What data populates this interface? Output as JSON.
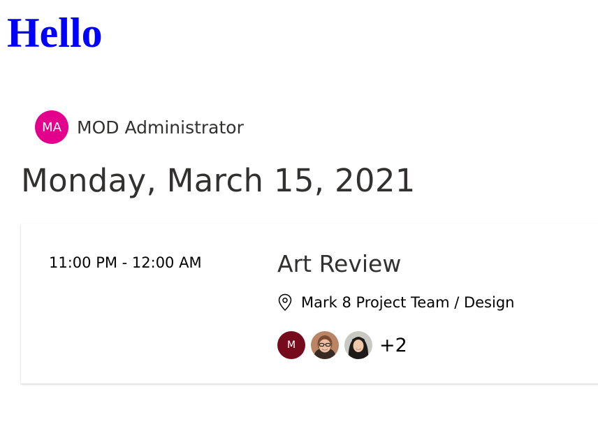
{
  "header": {
    "greeting": "Hello"
  },
  "person": {
    "initials": "MA",
    "name": "MOD Administrator",
    "avatar_color": "#e3008c"
  },
  "agenda": {
    "date": "Monday, March 15, 2021",
    "events": [
      {
        "time": "11:00 PM - 12:00 AM",
        "title": "Art Review",
        "location_icon": "location-pin-icon",
        "location": "Mark 8 Project Team / Design",
        "attendees": [
          {
            "initials": "M",
            "color": "#750b1c"
          },
          {
            "photo": "attendee-photo-1"
          },
          {
            "photo": "attendee-photo-2"
          }
        ],
        "more_count": "+2"
      }
    ]
  },
  "colors": {
    "heading": "#0000ff",
    "text_primary": "#323130"
  }
}
